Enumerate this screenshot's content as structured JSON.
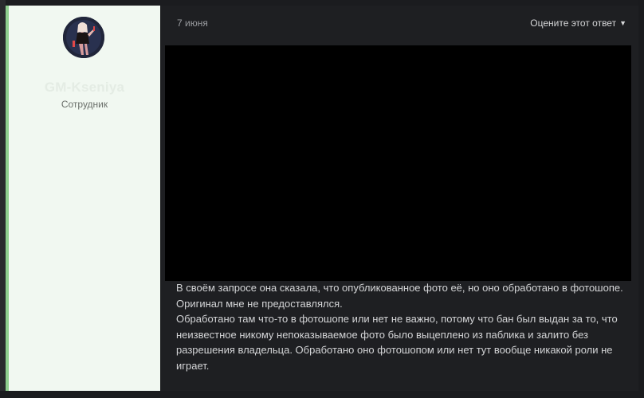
{
  "post": {
    "date": "7 июня",
    "rate_label": "Оцените этот ответ",
    "paragraphs": [
      "В своём запросе она сказала, что опубликованное фото её, но оно обработано в фотошопе. Оригинал мне не предоставлялся.",
      "Обработано там что-то в фотошопе или нет не важно, потому что бан был выдан за то, что неизвестное никому непоказываемое фото было выцеплено из паблика и залито без разрешения владельца. Обработано оно фотошопом или нет тут вообще никакой роли не играет."
    ]
  },
  "author": {
    "name": "GM-Kseniya",
    "role": "Сотрудник",
    "accent_color": "#8fcf8f"
  },
  "icons": {
    "rate_caret": "caret-down-icon"
  }
}
